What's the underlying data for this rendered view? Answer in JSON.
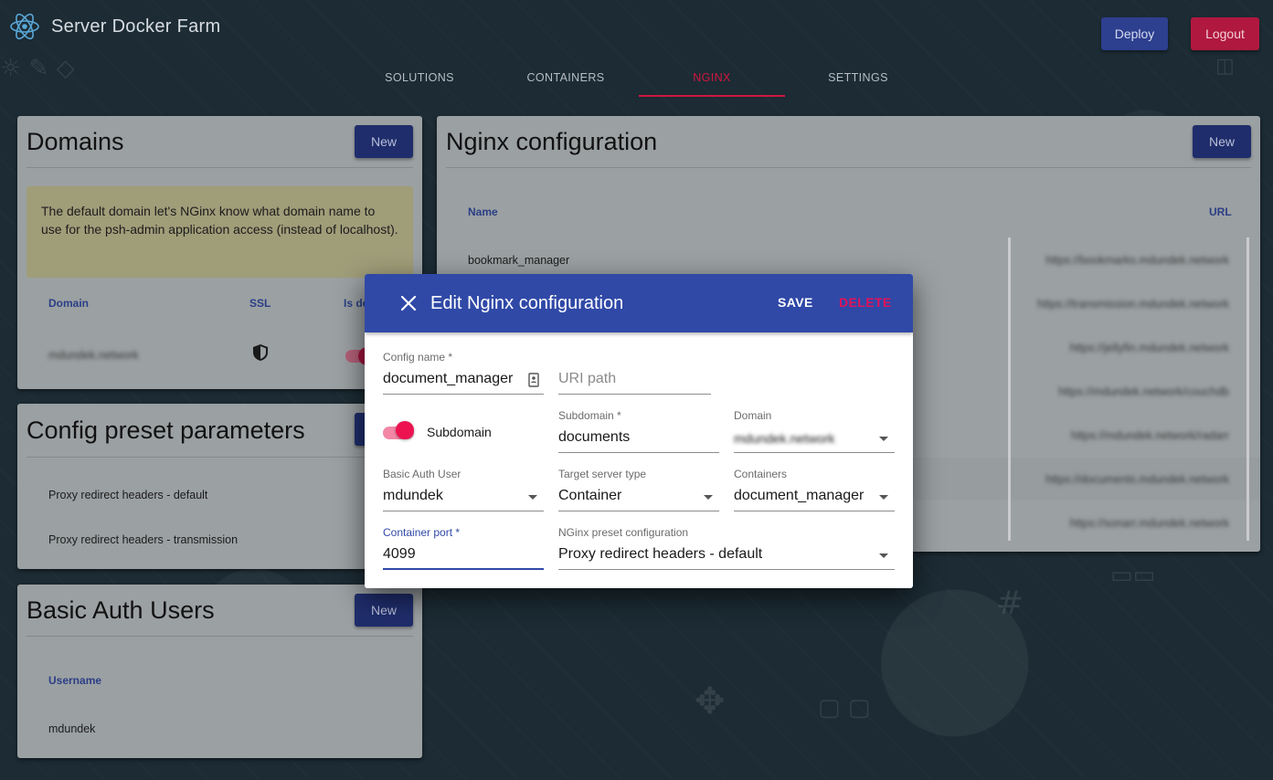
{
  "app": {
    "title": "Server Docker Farm",
    "deploy_label": "Deploy",
    "logout_label": "Logout"
  },
  "nav": {
    "tabs": [
      {
        "label": "SOLUTIONS"
      },
      {
        "label": "CONTAINERS"
      },
      {
        "label": "NGINX",
        "active": true
      },
      {
        "label": "SETTINGS"
      }
    ]
  },
  "domains": {
    "title": "Domains",
    "new_label": "New",
    "info": "The default domain let's NGinx know what domain name to use for the psh-admin application access (instead of localhost).",
    "columns": [
      "Domain",
      "SSL",
      "Is de"
    ],
    "rows": [
      {
        "domain": "mdundek.network",
        "ssl_icon": "shield-icon",
        "is_default": true
      }
    ]
  },
  "presets": {
    "title": "Config preset parameters",
    "items": [
      "Proxy redirect headers - default",
      "Proxy redirect headers - transmission"
    ]
  },
  "auth_users": {
    "title": "Basic Auth Users",
    "new_label": "New",
    "column": "Username",
    "rows": [
      "mdundek"
    ]
  },
  "nginx": {
    "title": "Nginx configuration",
    "new_label": "New",
    "columns": [
      "Name",
      "URL"
    ],
    "rows": [
      {
        "name": "bookmark_manager",
        "url": "https://bookmarks.mdundek.network"
      },
      {
        "name": "",
        "url": "https://transmission.mdundek.network"
      },
      {
        "name": "",
        "url": "https://jellyfin.mdundek.network"
      },
      {
        "name": "",
        "url": "https://mdundek.network/couchdb"
      },
      {
        "name": "",
        "url": "https://mdundek.network/radarr"
      },
      {
        "name": "",
        "url": "https://documents.mdundek.network"
      },
      {
        "name": "",
        "url": "https://sonarr.mdundek.network"
      }
    ]
  },
  "modal": {
    "title": "Edit Nginx configuration",
    "save_label": "SAVE",
    "delete_label": "DELETE",
    "config_name": {
      "label": "Config name *",
      "value": "document_manager"
    },
    "uri_path": {
      "placeholder": "URI path"
    },
    "subdomain_toggle": {
      "label": "Subdomain",
      "on": true
    },
    "subdomain": {
      "label": "Subdomain *",
      "value": "documents"
    },
    "domain": {
      "label": "Domain",
      "value": "mdundek.network"
    },
    "basic_auth_user": {
      "label": "Basic Auth User",
      "value": "mdundek"
    },
    "target_server_type": {
      "label": "Target server type",
      "value": "Container"
    },
    "containers": {
      "label": "Containers",
      "value": "document_manager"
    },
    "container_port": {
      "label": "Container port *",
      "value": "4099"
    },
    "nginx_preset": {
      "label": "NGinx preset configuration",
      "value": "Proxy redirect headers - default"
    }
  }
}
